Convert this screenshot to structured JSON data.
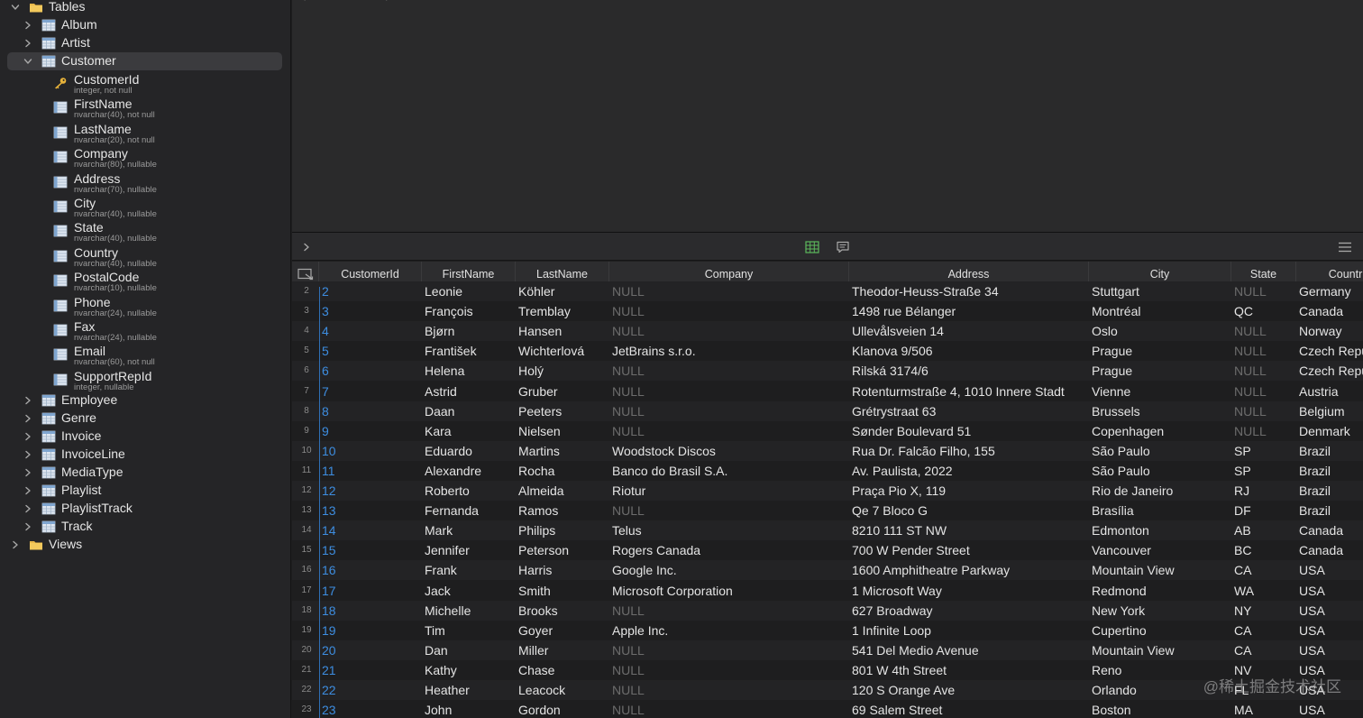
{
  "sidebar": {
    "tables_label": "Tables",
    "views_label": "Views",
    "tables_before": [
      {
        "name": "Album"
      },
      {
        "name": "Artist"
      }
    ],
    "selected_table": "Customer",
    "columns": [
      {
        "name": "CustomerId",
        "type": "integer, not null",
        "key": true
      },
      {
        "name": "FirstName",
        "type": "nvarchar(40), not null"
      },
      {
        "name": "LastName",
        "type": "nvarchar(20), not null"
      },
      {
        "name": "Company",
        "type": "nvarchar(80), nullable"
      },
      {
        "name": "Address",
        "type": "nvarchar(70), nullable"
      },
      {
        "name": "City",
        "type": "nvarchar(40), nullable"
      },
      {
        "name": "State",
        "type": "nvarchar(40), nullable"
      },
      {
        "name": "Country",
        "type": "nvarchar(40), nullable"
      },
      {
        "name": "PostalCode",
        "type": "nvarchar(10), nullable"
      },
      {
        "name": "Phone",
        "type": "nvarchar(24), nullable"
      },
      {
        "name": "Fax",
        "type": "nvarchar(24), nullable"
      },
      {
        "name": "Email",
        "type": "nvarchar(60), not null"
      },
      {
        "name": "SupportRepId",
        "type": "integer, nullable"
      }
    ],
    "tables_after": [
      {
        "name": "Employee"
      },
      {
        "name": "Genre"
      },
      {
        "name": "Invoice"
      },
      {
        "name": "InvoiceLine"
      },
      {
        "name": "MediaType"
      },
      {
        "name": "Playlist"
      },
      {
        "name": "PlaylistTrack"
      },
      {
        "name": "Track"
      }
    ]
  },
  "grid": {
    "columns": [
      "CustomerId",
      "FirstName",
      "LastName",
      "Company",
      "Address",
      "City",
      "State",
      "Countr"
    ],
    "rows": [
      {
        "n": "2",
        "id": "2",
        "first": "Leonie",
        "last": "Köhler",
        "company": "NULL",
        "address": "Theodor-Heuss-Straße 34",
        "city": "Stuttgart",
        "state": "NULL",
        "country": "Germany"
      },
      {
        "n": "3",
        "id": "3",
        "first": "François",
        "last": "Tremblay",
        "company": "NULL",
        "address": "1498 rue Bélanger",
        "city": "Montréal",
        "state": "QC",
        "country": "Canada"
      },
      {
        "n": "4",
        "id": "4",
        "first": "Bjørn",
        "last": "Hansen",
        "company": "NULL",
        "address": "Ullevålsveien 14",
        "city": "Oslo",
        "state": "NULL",
        "country": "Norway"
      },
      {
        "n": "5",
        "id": "5",
        "first": "František",
        "last": "Wichterlová",
        "company": "JetBrains s.r.o.",
        "address": "Klanova 9/506",
        "city": "Prague",
        "state": "NULL",
        "country": "Czech Repu"
      },
      {
        "n": "6",
        "id": "6",
        "first": "Helena",
        "last": "Holý",
        "company": "NULL",
        "address": "Rilská 3174/6",
        "city": "Prague",
        "state": "NULL",
        "country": "Czech Repu"
      },
      {
        "n": "7",
        "id": "7",
        "first": "Astrid",
        "last": "Gruber",
        "company": "NULL",
        "address": "Rotenturmstraße 4, 1010 Innere Stadt",
        "city": "Vienne",
        "state": "NULL",
        "country": "Austria"
      },
      {
        "n": "8",
        "id": "8",
        "first": "Daan",
        "last": "Peeters",
        "company": "NULL",
        "address": "Grétrystraat 63",
        "city": "Brussels",
        "state": "NULL",
        "country": "Belgium"
      },
      {
        "n": "9",
        "id": "9",
        "first": "Kara",
        "last": "Nielsen",
        "company": "NULL",
        "address": "Sønder Boulevard 51",
        "city": "Copenhagen",
        "state": "NULL",
        "country": "Denmark"
      },
      {
        "n": "10",
        "id": "10",
        "first": "Eduardo",
        "last": "Martins",
        "company": "Woodstock Discos",
        "address": "Rua Dr. Falcão Filho, 155",
        "city": "São Paulo",
        "state": "SP",
        "country": "Brazil"
      },
      {
        "n": "11",
        "id": "11",
        "first": "Alexandre",
        "last": "Rocha",
        "company": "Banco do Brasil S.A.",
        "address": "Av. Paulista, 2022",
        "city": "São Paulo",
        "state": "SP",
        "country": "Brazil"
      },
      {
        "n": "12",
        "id": "12",
        "first": "Roberto",
        "last": "Almeida",
        "company": "Riotur",
        "address": "Praça Pio X, 119",
        "city": "Rio de Janeiro",
        "state": "RJ",
        "country": "Brazil"
      },
      {
        "n": "13",
        "id": "13",
        "first": "Fernanda",
        "last": "Ramos",
        "company": "NULL",
        "address": "Qe 7 Bloco G",
        "city": "Brasília",
        "state": "DF",
        "country": "Brazil"
      },
      {
        "n": "14",
        "id": "14",
        "first": "Mark",
        "last": "Philips",
        "company": "Telus",
        "address": "8210 111 ST NW",
        "city": "Edmonton",
        "state": "AB",
        "country": "Canada"
      },
      {
        "n": "15",
        "id": "15",
        "first": "Jennifer",
        "last": "Peterson",
        "company": "Rogers Canada",
        "address": "700 W Pender Street",
        "city": "Vancouver",
        "state": "BC",
        "country": "Canada"
      },
      {
        "n": "16",
        "id": "16",
        "first": "Frank",
        "last": "Harris",
        "company": "Google Inc.",
        "address": "1600 Amphitheatre Parkway",
        "city": "Mountain View",
        "state": "CA",
        "country": "USA"
      },
      {
        "n": "17",
        "id": "17",
        "first": "Jack",
        "last": "Smith",
        "company": "Microsoft Corporation",
        "address": "1 Microsoft Way",
        "city": "Redmond",
        "state": "WA",
        "country": "USA"
      },
      {
        "n": "18",
        "id": "18",
        "first": "Michelle",
        "last": "Brooks",
        "company": "NULL",
        "address": "627 Broadway",
        "city": "New York",
        "state": "NY",
        "country": "USA"
      },
      {
        "n": "19",
        "id": "19",
        "first": "Tim",
        "last": "Goyer",
        "company": "Apple Inc.",
        "address": "1 Infinite Loop",
        "city": "Cupertino",
        "state": "CA",
        "country": "USA"
      },
      {
        "n": "20",
        "id": "20",
        "first": "Dan",
        "last": "Miller",
        "company": "NULL",
        "address": "541 Del Medio Avenue",
        "city": "Mountain View",
        "state": "CA",
        "country": "USA"
      },
      {
        "n": "21",
        "id": "21",
        "first": "Kathy",
        "last": "Chase",
        "company": "NULL",
        "address": "801 W 4th Street",
        "city": "Reno",
        "state": "NV",
        "country": "USA"
      },
      {
        "n": "22",
        "id": "22",
        "first": "Heather",
        "last": "Leacock",
        "company": "NULL",
        "address": "120 S Orange Ave",
        "city": "Orlando",
        "state": "FL",
        "country": "USA"
      },
      {
        "n": "23",
        "id": "23",
        "first": "John",
        "last": "Gordon",
        "company": "NULL",
        "address": "69 Salem Street",
        "city": "Boston",
        "state": "MA",
        "country": "USA"
      }
    ]
  },
  "watermark": "@稀土掘金技术社区",
  "colors": {
    "id_link": "#3d8de0",
    "null_text": "#6c6c6c",
    "folder": "#e9b84a",
    "key": "#e8b33a",
    "grid_icon": "#5cb85c"
  }
}
